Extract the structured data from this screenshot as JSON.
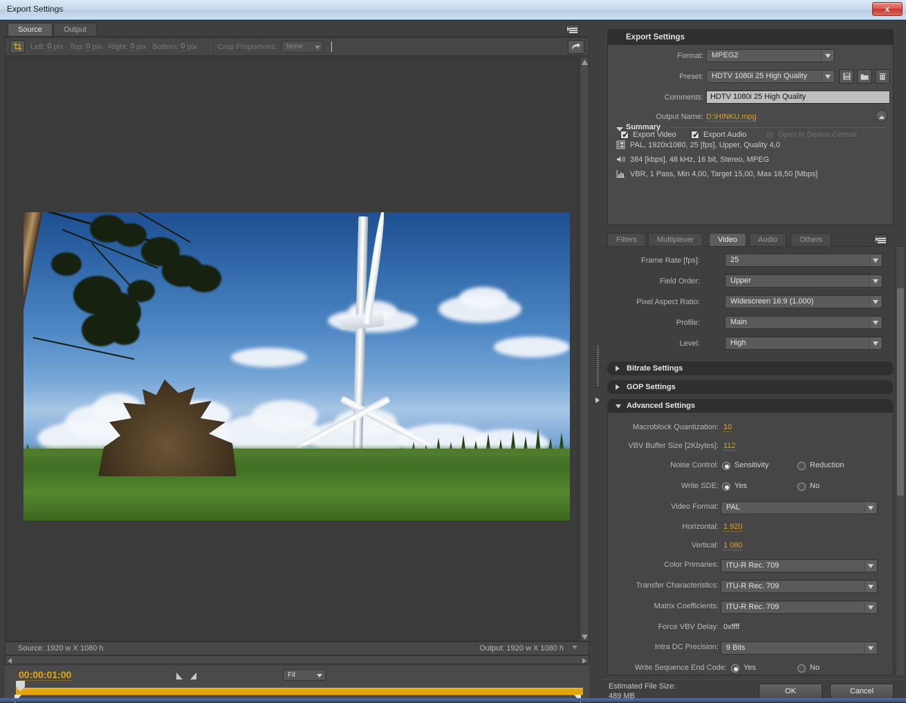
{
  "window": {
    "title": "Export Settings",
    "close_label": "x"
  },
  "left_pane": {
    "tabs": [
      {
        "label": "Source",
        "active": true
      },
      {
        "label": "Output",
        "active": false
      }
    ],
    "panel_menu_icon": "panel-menu-icon",
    "crop_toolbar": {
      "crop_tool_icon": "crop-tool-icon",
      "left_label": "Left:",
      "left_value": "0",
      "left_unit": "pix",
      "top_label": "Top:",
      "top_value": "0",
      "top_unit": "pix",
      "right_label": "Right:",
      "right_value": "0",
      "right_unit": "pix",
      "bottom_label": "Bottom:",
      "bottom_value": "0",
      "bottom_unit": "pix",
      "crop_proportions_label": "Crop Proportions:",
      "crop_proportions_value": "None",
      "export_frame_icon": "export-frame-icon"
    },
    "info_bar": {
      "source": "Source: 1920 w X 1080 h",
      "output": "Output: 1920 w X 1080 h"
    },
    "transport": {
      "timecode": "00:00:01:00",
      "mark_in_icon": "mark-in-icon",
      "mark_out_icon": "mark-out-icon",
      "zoom_level": "Fit"
    }
  },
  "export_settings": {
    "header": "Export Settings",
    "format_label": "Format:",
    "format_value": "MPEG2",
    "preset_label": "Preset:",
    "preset_value": "HDTV 1080i 25 High Quality",
    "save_preset_icon": "save-preset-icon",
    "import_preset_icon": "import-preset-icon",
    "delete_preset_icon": "delete-preset-icon",
    "comments_label": "Comments:",
    "comments_value": "HDTV 1080i 25 High Quality",
    "output_name_label": "Output Name:",
    "output_name_value": "D:\\HINKU.mpg",
    "export_video_label": "Export Video",
    "export_video_checked": true,
    "export_audio_label": "Export Audio",
    "export_audio_checked": true,
    "device_central_label": "Open in Device Central",
    "device_central_checked": false,
    "device_central_enabled": false,
    "collapse_icon": "collapse-chevron-icon",
    "summary_label": "Summary",
    "summary": [
      {
        "icon": "film-icon",
        "text": "PAL, 1920x1080, 25 [fps], Upper, Quality 4,0"
      },
      {
        "icon": "speaker-icon",
        "text": "384 [kbps], 48 kHz, 16 bit, Stereo, MPEG"
      },
      {
        "icon": "bitrate-icon",
        "text": "VBR, 1 Pass, Min 4,00, Target 15,00, Max 18,50 [Mbps]"
      }
    ]
  },
  "settings_tabs": [
    {
      "label": "Filters",
      "active": false
    },
    {
      "label": "Multiplexer",
      "active": false
    },
    {
      "label": "Video",
      "active": true
    },
    {
      "label": "Audio",
      "active": false
    },
    {
      "label": "Others",
      "active": false
    }
  ],
  "video_tab": {
    "rows": [
      {
        "label": "Frame Rate [fps]:",
        "value": "25"
      },
      {
        "label": "Field Order:",
        "value": "Upper"
      },
      {
        "label": "Pixel Aspect Ratio:",
        "value": "Widescreen 16:9 (1,000)"
      },
      {
        "label": "Profile:",
        "value": "Main"
      },
      {
        "label": "Level:",
        "value": "High"
      }
    ]
  },
  "sections": {
    "bitrate": {
      "label": "Bitrate Settings",
      "expanded": false
    },
    "gop": {
      "label": "GOP Settings",
      "expanded": false
    },
    "advanced": {
      "label": "Advanced Settings",
      "expanded": true
    }
  },
  "advanced": {
    "macroblock_label": "Macroblock Quantization:",
    "macroblock_value": "10",
    "vbv_buffer_label": "VBV Buffer Size [2Kbytes]:",
    "vbv_buffer_value": "112",
    "noise_control_label": "Noise Control:",
    "noise_control_opt1": "Sensitivity",
    "noise_control_opt2": "Reduction",
    "noise_control_selected": "Sensitivity",
    "write_sde_label": "Write SDE:",
    "write_sde_opt1": "Yes",
    "write_sde_opt2": "No",
    "write_sde_selected": "Yes",
    "video_format_label": "Video Format:",
    "video_format_value": "PAL",
    "horizontal_label": "Horizontal:",
    "horizontal_value": "1 920",
    "vertical_label": "Vertical:",
    "vertical_value": "1 080",
    "color_primaries_label": "Color Primaries:",
    "color_primaries_value": "ITU-R Rec. 709",
    "transfer_char_label": "Transfer Characteristics:",
    "transfer_char_value": "ITU-R Rec. 709",
    "matrix_coeff_label": "Matrix Coefficients:",
    "matrix_coeff_value": "ITU-R Rec. 709",
    "force_vbv_label": "Force VBV Delay:",
    "force_vbv_value": "0xffff",
    "intra_dc_label": "Intra DC Precision:",
    "intra_dc_value": "9 Bits",
    "write_seq_label": "Write Sequence End Code:",
    "write_seq_opt1": "Yes",
    "write_seq_opt2": "No",
    "write_seq_selected": "Yes"
  },
  "footer": {
    "estimated_label": "Estimated File Size:",
    "estimated_value": "489 MB",
    "ok_label": "OK",
    "cancel_label": "Cancel"
  },
  "colors": {
    "accent_orange": "#dfa225",
    "timeline": "#e0a60c",
    "panel_bg": "#3f3f3f",
    "header_bg": "#2f2f2f",
    "close_red": "#c8352d"
  }
}
